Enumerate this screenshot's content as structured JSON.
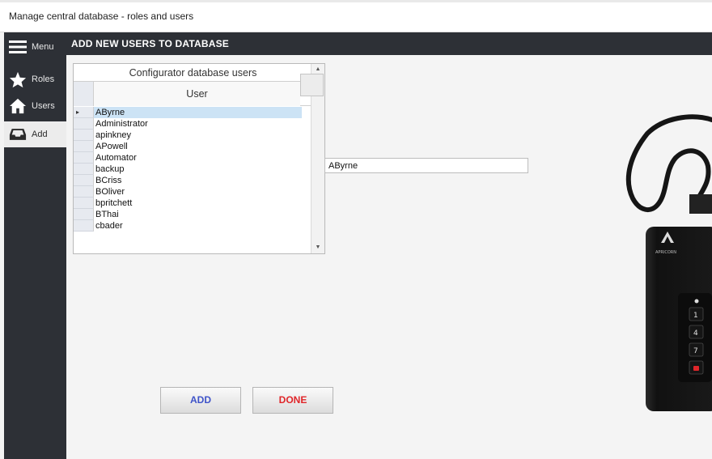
{
  "window": {
    "title": "Manage central database - roles and users"
  },
  "sidebar": {
    "menu_label": "Menu",
    "items": [
      {
        "label": "Roles",
        "icon": "star-icon",
        "active": false
      },
      {
        "label": "Users",
        "icon": "home-icon",
        "active": false
      },
      {
        "label": "Add",
        "icon": "inbox-icon",
        "active": true
      }
    ]
  },
  "header": {
    "title": "ADD NEW USERS TO DATABASE"
  },
  "grid": {
    "caption": "Configurator database users",
    "column_header": "User",
    "selected_indicator": "▸",
    "rows": [
      "AByrne",
      "Administrator",
      "apinkney",
      "APowell",
      "Automator",
      "backup",
      "BCriss",
      "BOliver",
      "bpritchett",
      "BThai",
      "cbader"
    ],
    "selected_index": 0
  },
  "name_field": {
    "value": "AByrne"
  },
  "buttons": {
    "add_label": "ADD",
    "done_label": "DONE"
  },
  "device": {
    "brand_text": "APRICORN",
    "keys": [
      "1",
      "4",
      "7"
    ]
  },
  "colors": {
    "dark": "#2d3036",
    "add_text": "#3e53c9",
    "done_text": "#e0262a",
    "selection": "#cce3f5"
  }
}
